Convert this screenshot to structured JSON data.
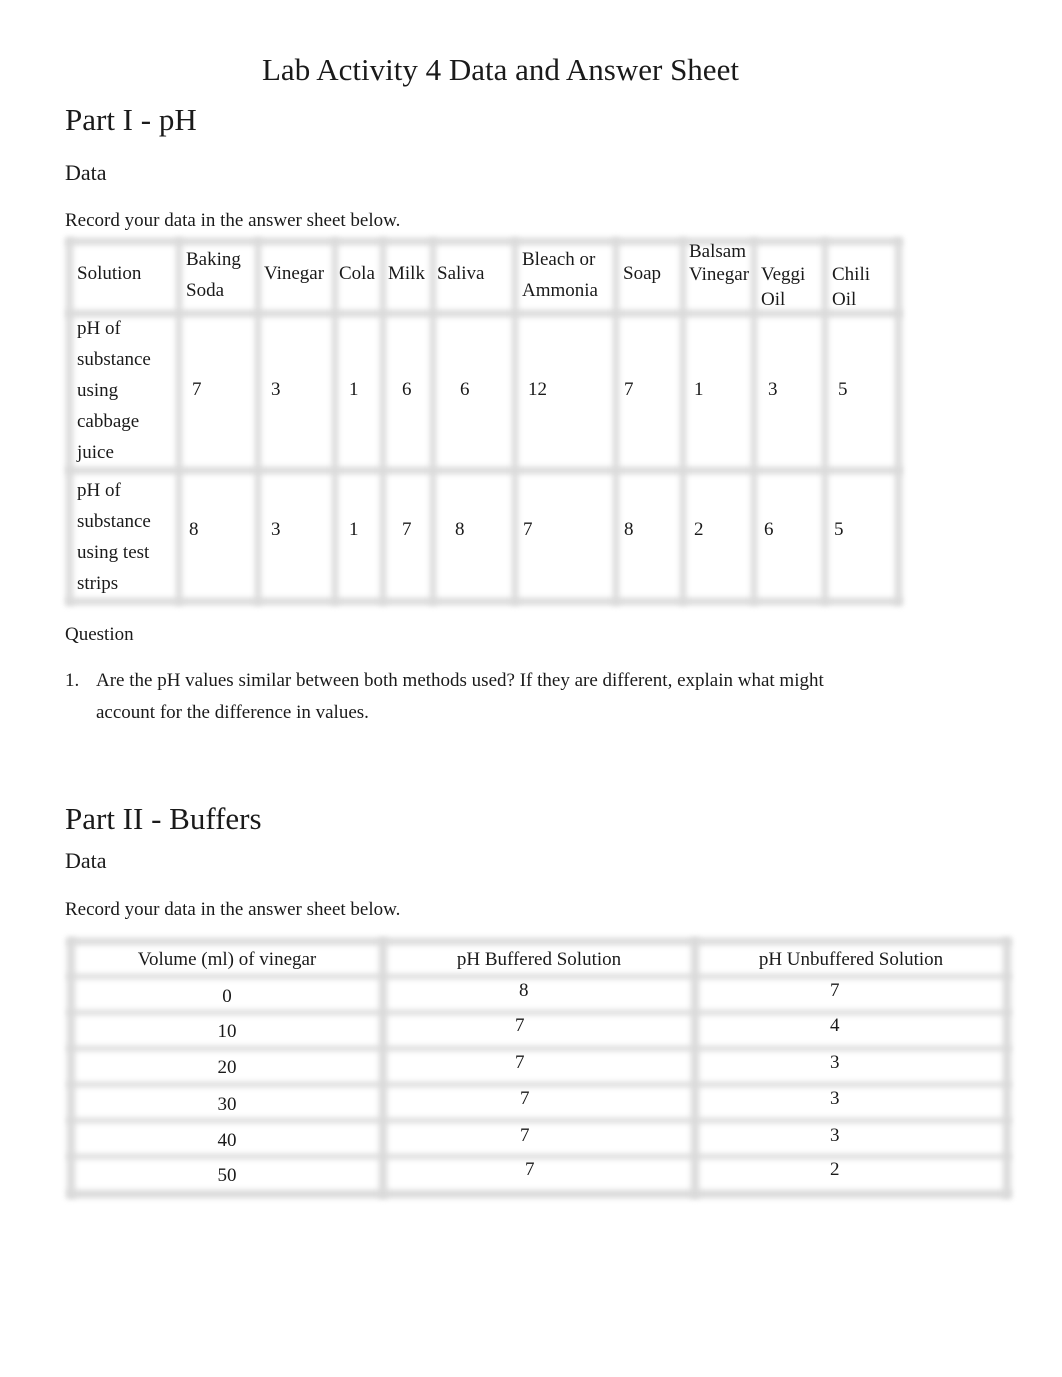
{
  "document": {
    "title": "Lab Activity 4 Data and Answer Sheet",
    "part1": {
      "heading": "Part I - pH",
      "data_heading": "Data",
      "instruction": "Record your data in the answer sheet below.",
      "table": {
        "row_header_label": "Solution",
        "columns": [
          "Baking Soda",
          "Vinegar",
          "Cola",
          "Milk",
          "Saliva",
          "Bleach or Ammonia",
          "Soap",
          "Balsam Vinegar",
          "Veggi Oil",
          "Chili Oil"
        ],
        "rows": [
          {
            "label": "pH of substance using cabbage juice",
            "values": [
              "7",
              "3",
              "1",
              "6",
              "6",
              "12",
              "7",
              "1",
              "3",
              "5"
            ]
          },
          {
            "label": "pH of substance using test strips",
            "values": [
              "8",
              "3",
              "1",
              "7",
              "8",
              "7",
              "8",
              "2",
              "6",
              "5"
            ]
          }
        ]
      },
      "question_heading": "Question",
      "questions": [
        {
          "number": "1.",
          "line1": "Are the pH values similar between both methods used? If they are different, explain what might",
          "line2": "account for the difference in values."
        }
      ]
    },
    "part2": {
      "heading": "Part II - Buffers",
      "data_heading": "Data",
      "instruction": "Record your data in the answer sheet below.",
      "table": {
        "headers": [
          "Volume (ml) of vinegar",
          "pH Buffered Solution",
          "pH Unbuffered Solution"
        ],
        "rows": [
          [
            "0",
            "8",
            "7"
          ],
          [
            "10",
            "7",
            "4"
          ],
          [
            "20",
            "7",
            "3"
          ],
          [
            "30",
            "7",
            "3"
          ],
          [
            "40",
            "7",
            "3"
          ],
          [
            "50",
            "7",
            "2"
          ]
        ]
      }
    }
  }
}
